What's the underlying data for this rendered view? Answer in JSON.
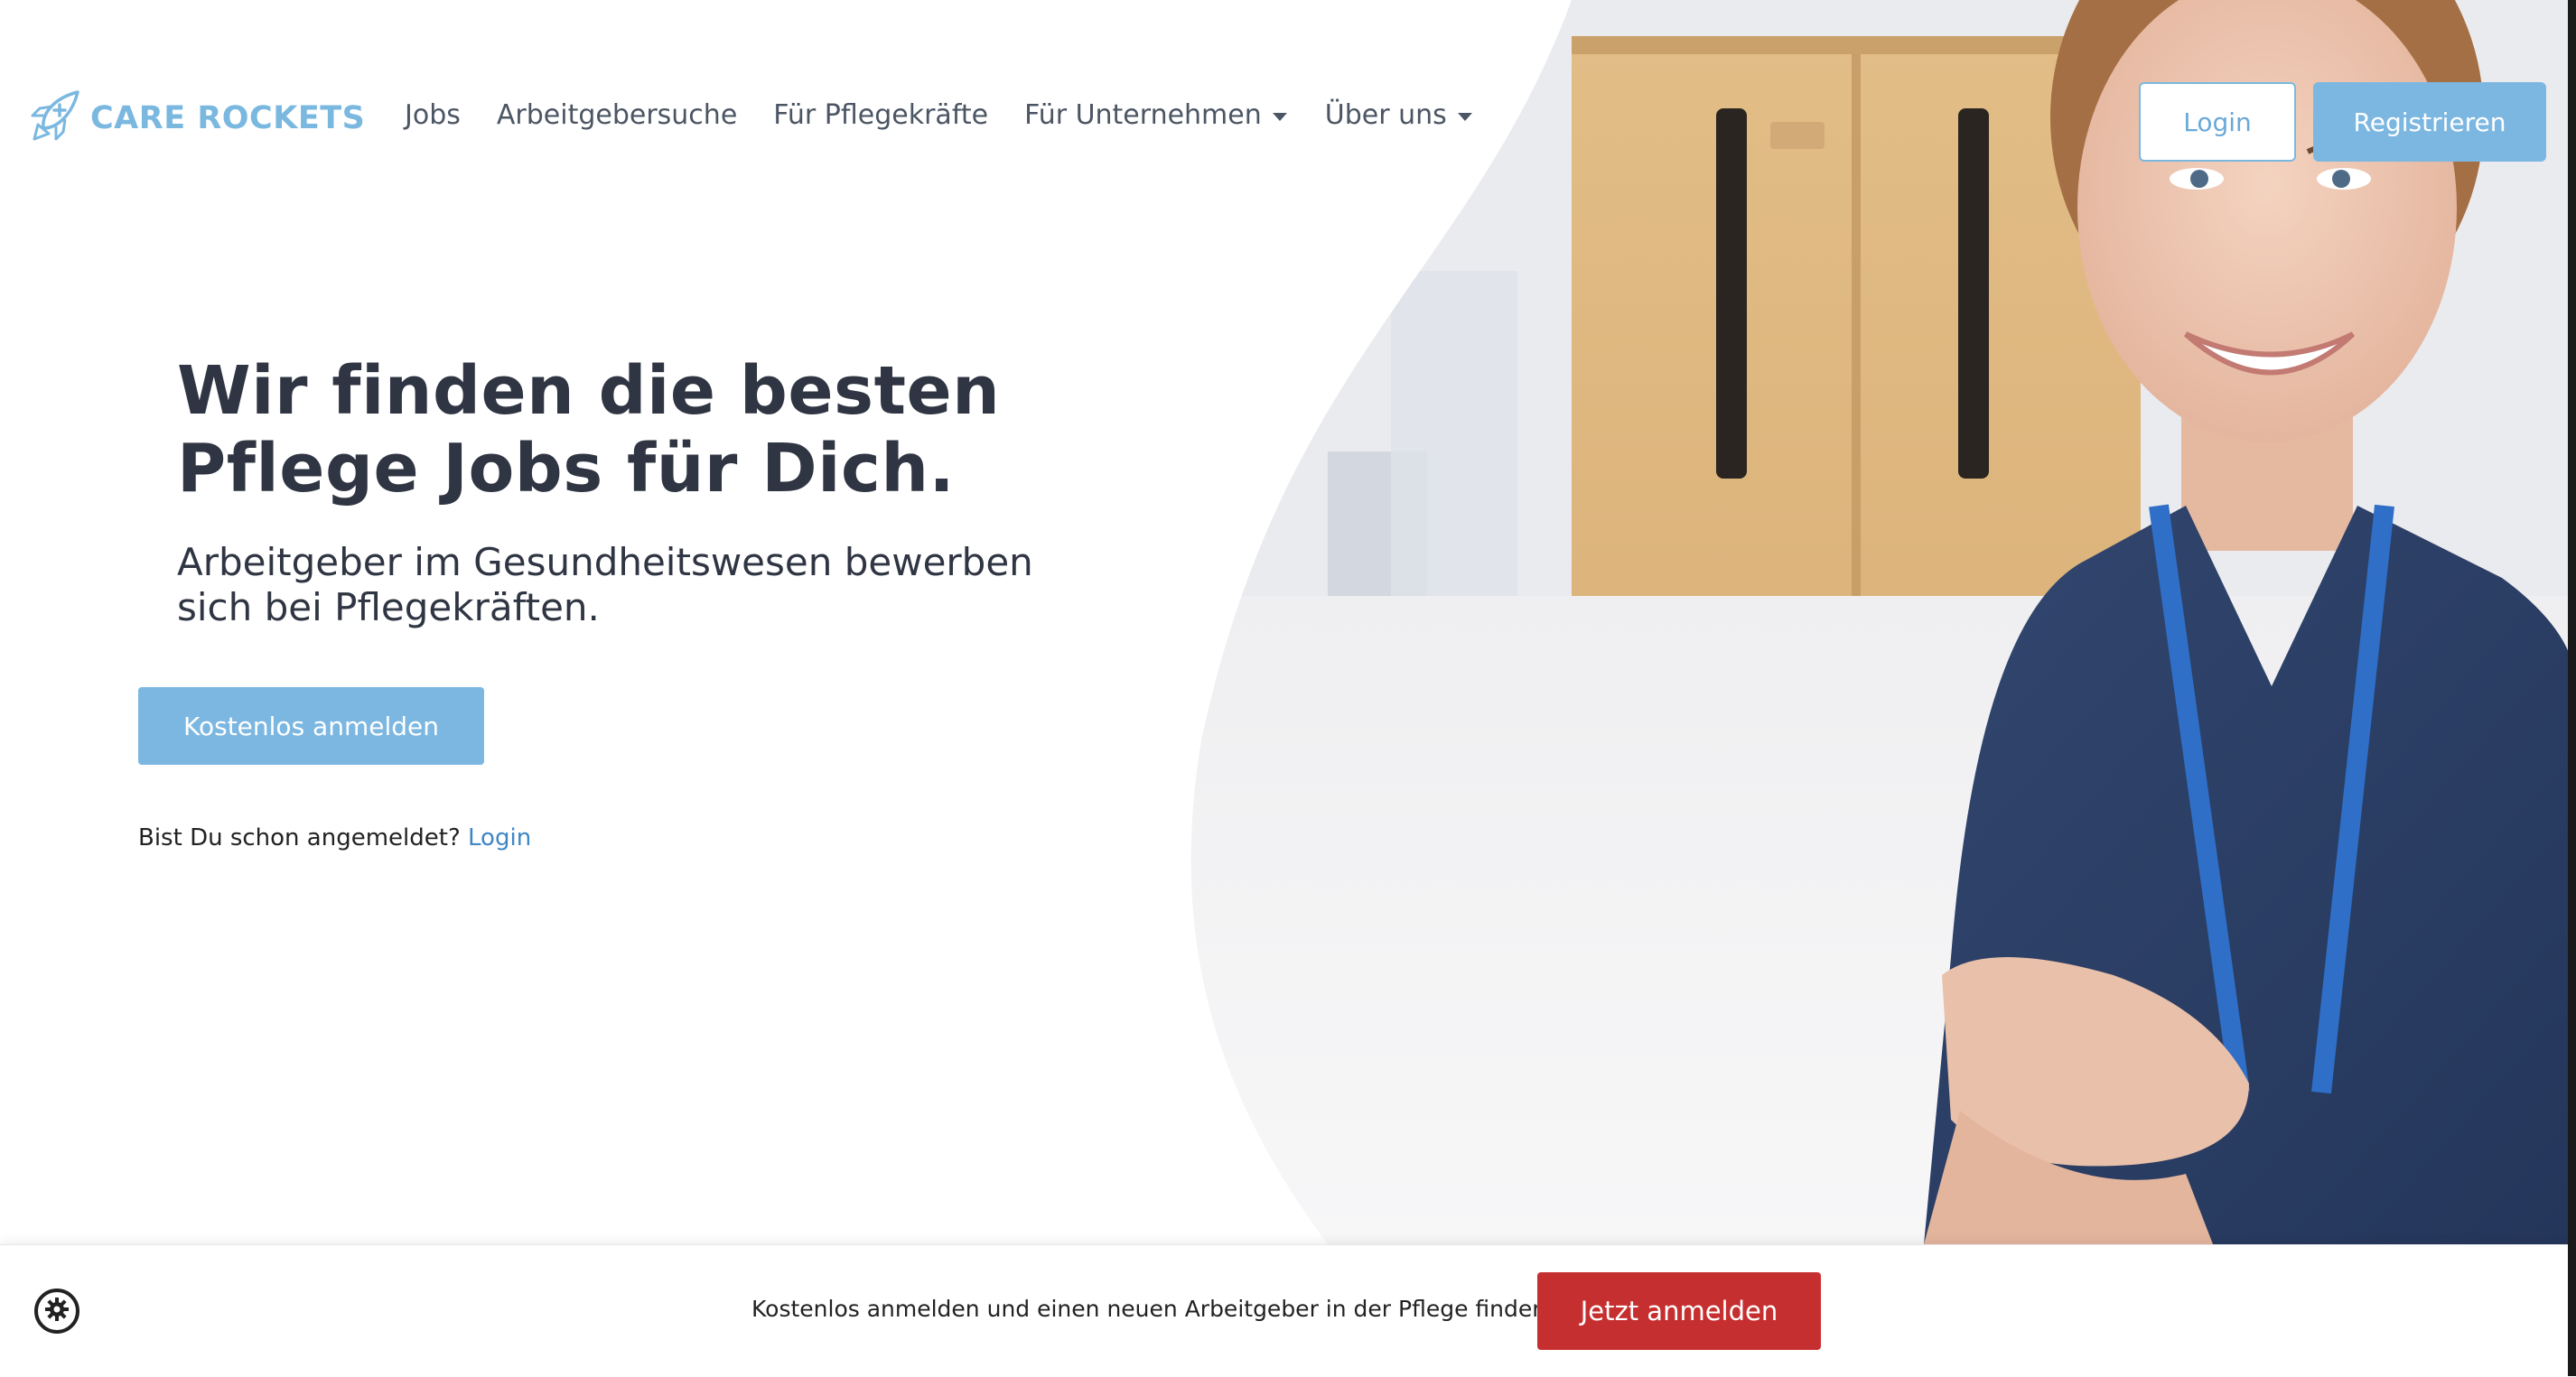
{
  "brand": {
    "name": "CARE ROCKETS",
    "logo_icon": "rocket-icon",
    "color": "#7ab8e0"
  },
  "nav": {
    "items": [
      {
        "label": "Jobs",
        "dropdown": false
      },
      {
        "label": "Arbeitgebersuche",
        "dropdown": false
      },
      {
        "label": "Für Pflegekräfte",
        "dropdown": false
      },
      {
        "label": "Für Unternehmen",
        "dropdown": true
      },
      {
        "label": "Über uns",
        "dropdown": true
      }
    ],
    "login_label": "Login",
    "register_label": "Registrieren"
  },
  "hero": {
    "headline_line1": "Wir finden die besten",
    "headline_line2": "Pflege Jobs für Dich.",
    "subline_line1": "Arbeitgeber im Gesundheitswesen bewerben",
    "subline_line2": "sich bei Pflegekräften.",
    "cta_label": "Kostenlos anmelden",
    "already_text": "Bist Du schon angemeldet?",
    "already_link": "Login"
  },
  "bottom_bar": {
    "settings_icon": "gear-icon",
    "text": "Kostenlos anmelden und einen neuen Arbeitgeber in der Pflege finden.",
    "button_label": "Jetzt anmelden"
  },
  "colors": {
    "accent": "#7cb7e2",
    "cta_red": "#c62f30",
    "link": "#3f86c4",
    "text": "#2f3542"
  }
}
